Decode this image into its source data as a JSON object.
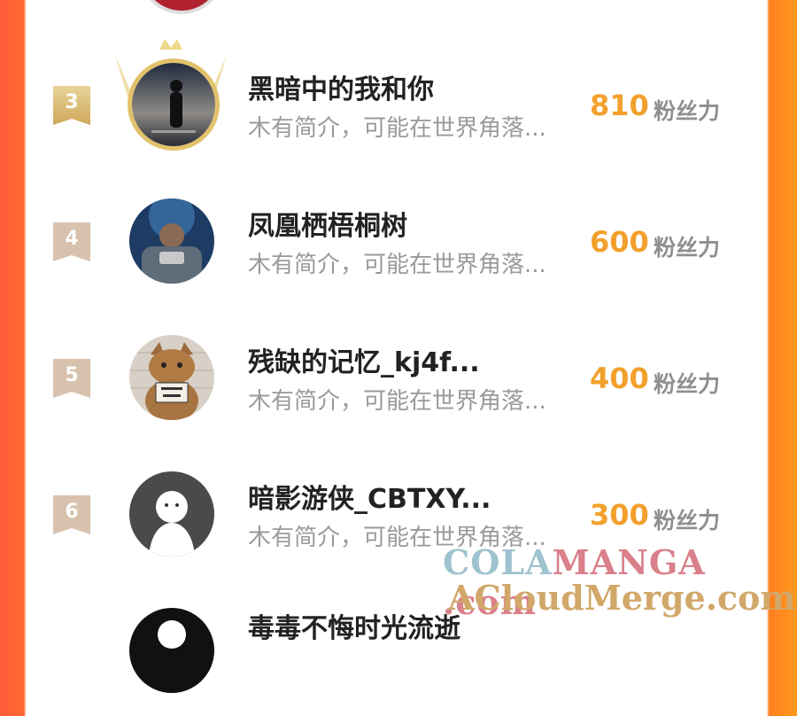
{
  "ranking": {
    "entries": [
      {
        "rank": "3",
        "name": "黑暗中的我和你",
        "bio": "木有简介，可能在世界角落...",
        "score": "810",
        "unit": "粉丝力",
        "avatar_icon": "dark-figure-avatar"
      },
      {
        "rank": "4",
        "name": "凤凰栖梧桐树",
        "bio": "木有简介，可能在世界角落...",
        "score": "600",
        "unit": "粉丝力",
        "avatar_icon": "space-soldier-avatar"
      },
      {
        "rank": "5",
        "name": "残缺的记忆_kj4f...",
        "bio": "木有简介，可能在世界角落...",
        "score": "400",
        "unit": "粉丝力",
        "avatar_icon": "cat-avatar"
      },
      {
        "rank": "6",
        "name": "暗影游侠_CBTXY...",
        "bio": "木有简介，可能在世界角落...",
        "score": "300",
        "unit": "粉丝力",
        "avatar_icon": "default-user-avatar"
      },
      {
        "rank": "",
        "name": "毒毒不悔时光流逝",
        "bio": "",
        "score": "",
        "unit": "",
        "avatar_icon": "default-user-avatar"
      }
    ]
  },
  "watermark": {
    "line1_a": "COLA",
    "line1_b": "MANGA",
    "line1_c": " .com",
    "line2": "ACloudMerge.com"
  },
  "colors": {
    "score": "#f2a02c",
    "gold_badge": "#cfa85a",
    "plain_badge": "#d8c2ad"
  }
}
